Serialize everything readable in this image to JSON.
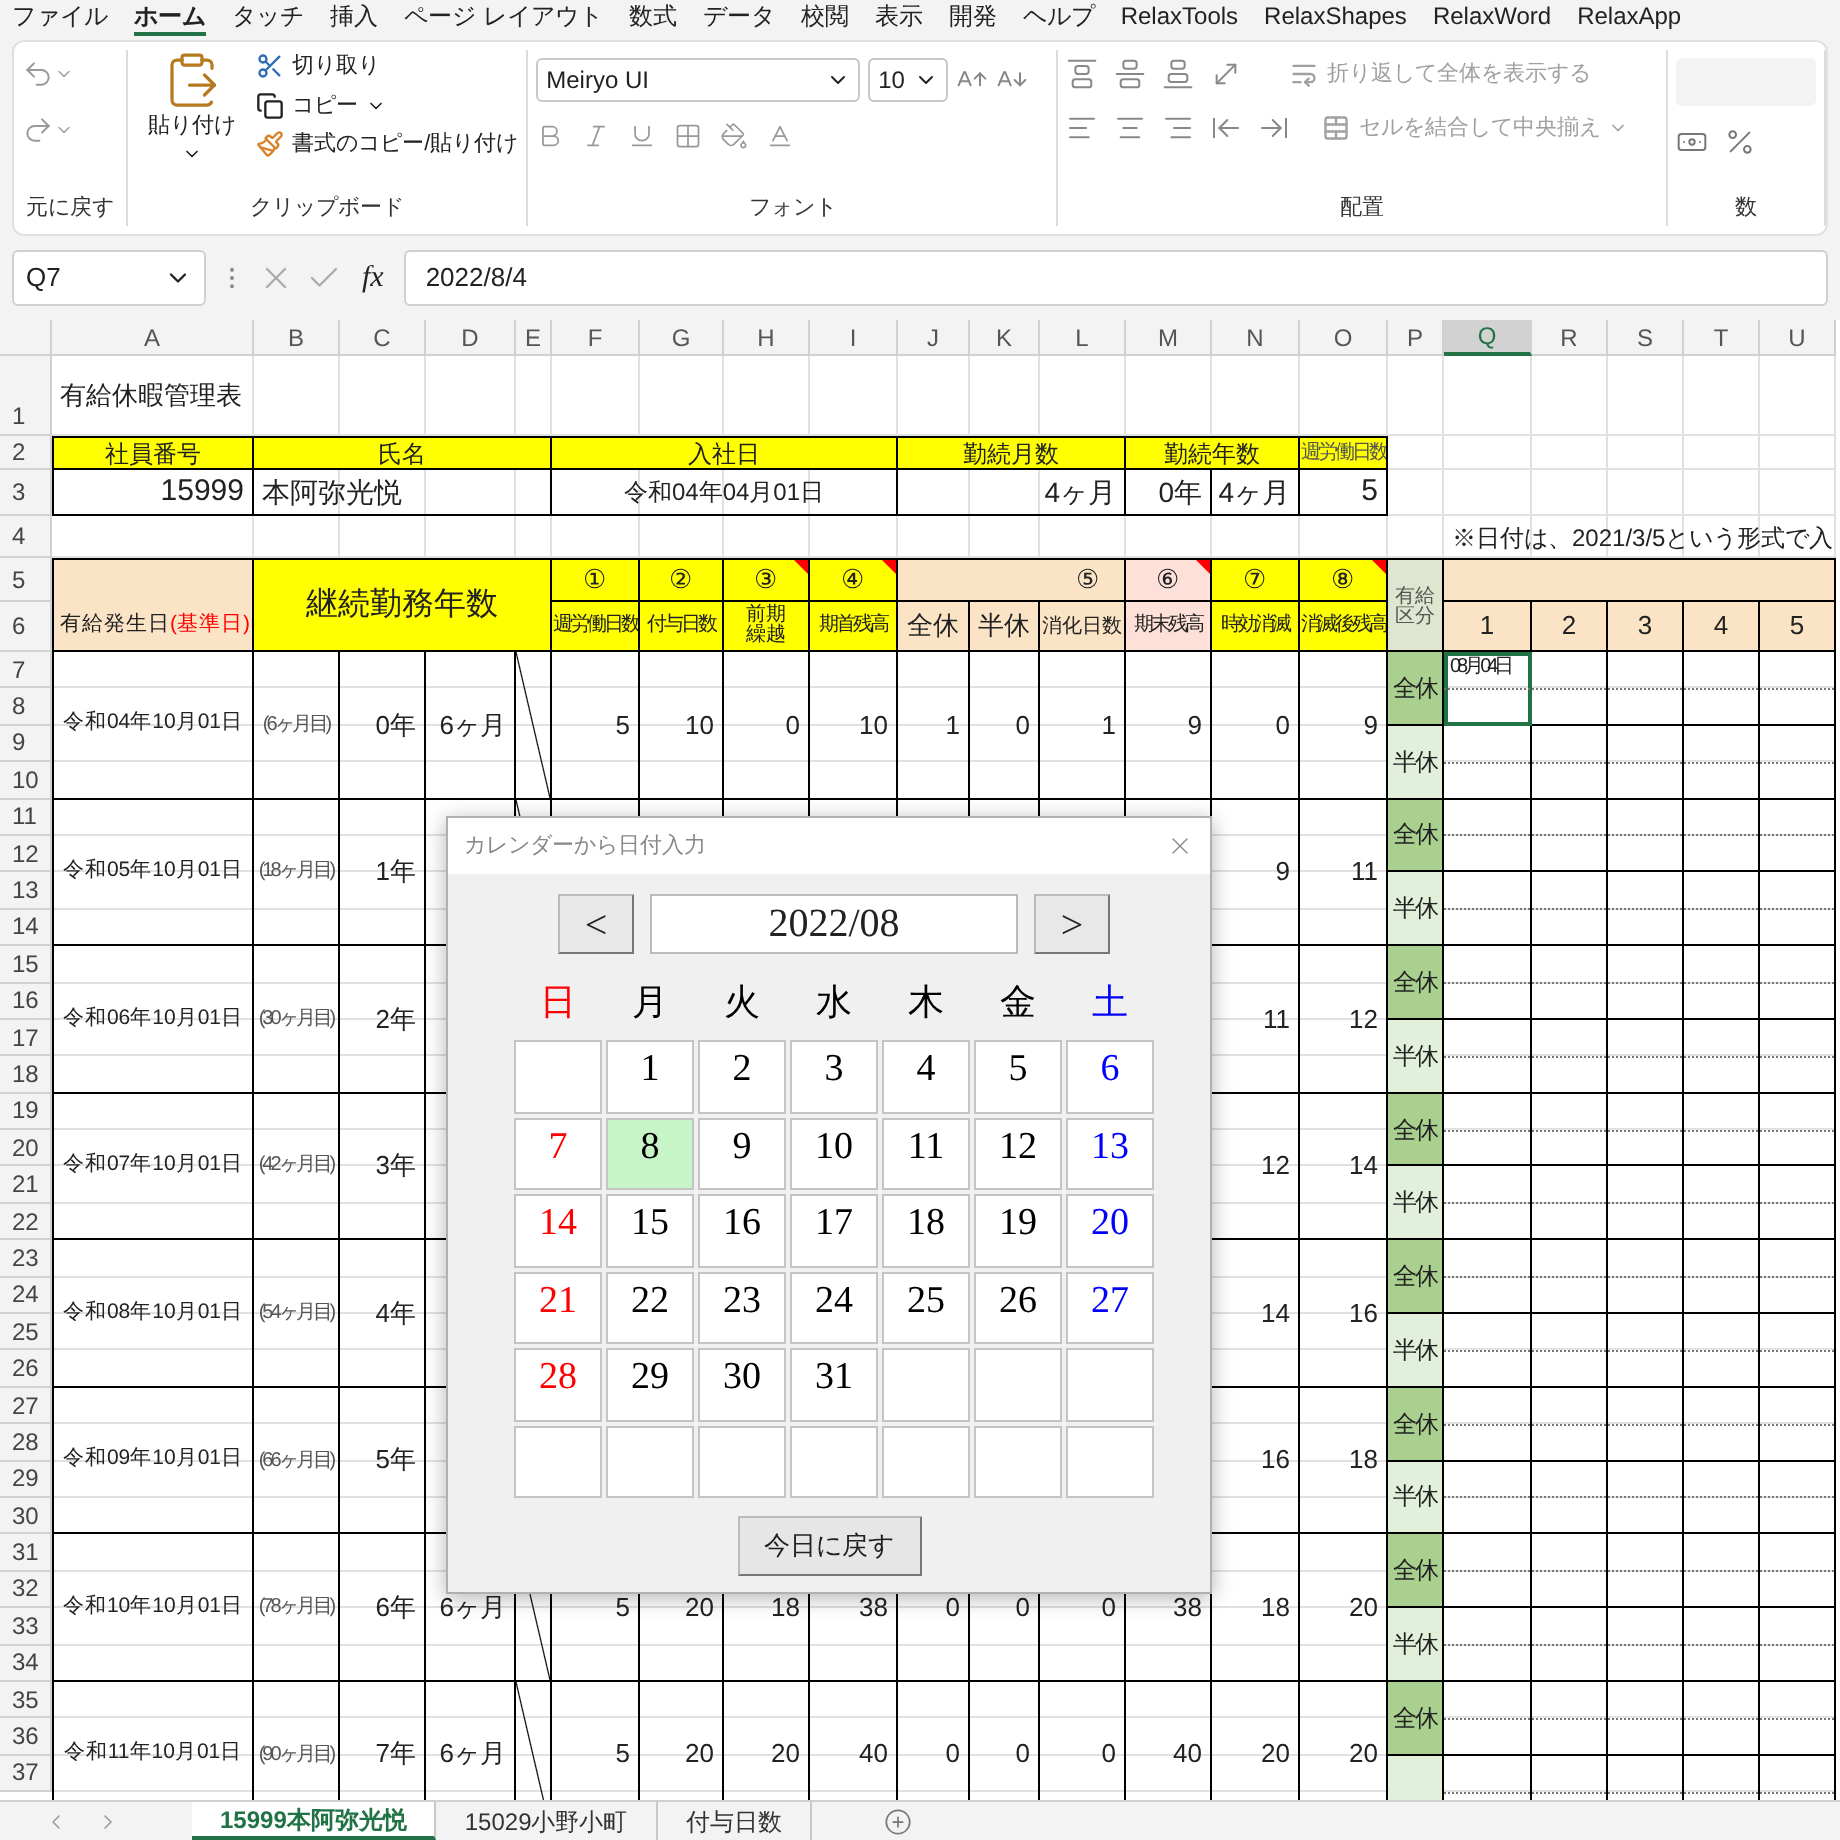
{
  "menu_tabs": [
    {
      "label": "ファイル",
      "selected": false
    },
    {
      "label": "ホーム",
      "selected": true
    },
    {
      "label": "タッチ",
      "selected": false
    },
    {
      "label": "挿入",
      "selected": false
    },
    {
      "label": "ページ レイアウト",
      "selected": false
    },
    {
      "label": "数式",
      "selected": false
    },
    {
      "label": "データ",
      "selected": false
    },
    {
      "label": "校閲",
      "selected": false
    },
    {
      "label": "表示",
      "selected": false
    },
    {
      "label": "開発",
      "selected": false
    },
    {
      "label": "ヘルプ",
      "selected": false
    },
    {
      "label": "RelaxTools",
      "selected": false
    },
    {
      "label": "RelaxShapes",
      "selected": false
    },
    {
      "label": "RelaxWord",
      "selected": false
    },
    {
      "label": "RelaxApp",
      "selected": false
    }
  ],
  "ribbon": {
    "undo": {
      "group_label": "元に戻す"
    },
    "clipboard": {
      "paste": "貼り付け",
      "cut": "切り取り",
      "copy": "コピー",
      "format_painter": "書式のコピー/貼り付け",
      "group_label": "クリップボード"
    },
    "font": {
      "font_name": "Meiryo UI",
      "font_size": "10",
      "group_label": "フォント"
    },
    "alignment": {
      "wrap_text": {
        "label": "折り返して全体を表示する",
        "disabled": true
      },
      "merge_center": {
        "label": "セルを結合して中央揃え",
        "disabled": true
      },
      "group_label": "配置"
    },
    "number": {
      "group_label": "数"
    }
  },
  "formula_bar": {
    "name_box": "Q7",
    "function_label": "fx",
    "formula": "2022/8/4"
  },
  "columns": [
    {
      "label": "A",
      "selected": false
    },
    {
      "label": "B",
      "selected": false
    },
    {
      "label": "C",
      "selected": false
    },
    {
      "label": "D",
      "selected": false
    },
    {
      "label": "E",
      "selected": false
    },
    {
      "label": "F",
      "selected": false
    },
    {
      "label": "G",
      "selected": false
    },
    {
      "label": "H",
      "selected": false
    },
    {
      "label": "I",
      "selected": false
    },
    {
      "label": "J",
      "selected": false
    },
    {
      "label": "K",
      "selected": false
    },
    {
      "label": "L",
      "selected": false
    },
    {
      "label": "M",
      "selected": false
    },
    {
      "label": "N",
      "selected": false
    },
    {
      "label": "O",
      "selected": false
    },
    {
      "label": "P",
      "selected": false
    },
    {
      "label": "Q",
      "selected": true
    },
    {
      "label": "R",
      "selected": false
    },
    {
      "label": "S",
      "selected": false
    },
    {
      "label": "T",
      "selected": false
    },
    {
      "label": "U",
      "selected": false
    }
  ],
  "row_numbers": [
    "1",
    "2",
    "3",
    "4",
    "5",
    "6",
    "7",
    "8",
    "9",
    "10",
    "11",
    "12",
    "13",
    "14",
    "15",
    "16",
    "17",
    "18",
    "19",
    "20",
    "21",
    "22",
    "23",
    "24",
    "25",
    "26",
    "27",
    "28",
    "29",
    "30",
    "31",
    "32",
    "33",
    "34",
    "35",
    "36",
    "37"
  ],
  "sheet": {
    "title": "有給休暇管理表",
    "employee_headers": [
      "社員番号",
      "氏名",
      "入社日",
      "勤続月数",
      "勤続年数",
      "週労働日数"
    ],
    "employee": {
      "id": "15999",
      "name": "本阿弥光悦",
      "hire_date": "令和04年04月01日",
      "service_months": "4ヶ月",
      "service_years": "0年",
      "service_year_months": "4ヶ月",
      "weekly_days": "5"
    },
    "note": "※日付は、2021/3/5という形式で入",
    "header": {
      "grant_date": "有給発生日",
      "grant_date_suffix": "(基準日)",
      "service_length": "継続勤務年数",
      "numbered": [
        {
          "mark": "①",
          "label": "週労働日数",
          "color": "#ffff00",
          "comment": false
        },
        {
          "mark": "②",
          "label": "付与日数",
          "color": "#ffff00",
          "comment": false
        },
        {
          "mark": "③",
          "label": "前期繰越",
          "color": "#ffff00",
          "comment": true
        },
        {
          "mark": "④",
          "label": "期首残高",
          "color": "#ffff00",
          "comment": true
        },
        {
          "mark": "⑤",
          "sub_labels": [
            "全休",
            "半休",
            "消化日数"
          ],
          "color": "#fbe4c6",
          "comment": false
        },
        {
          "mark": "⑥",
          "label": "期末残高",
          "color": "#fde0d8",
          "comment": true
        },
        {
          "mark": "⑦",
          "label": "時効消滅",
          "color": "#ffff00",
          "comment": false
        },
        {
          "mark": "⑧",
          "label": "消滅後残高",
          "color": "#ffff00",
          "comment": true
        }
      ],
      "category": "有給区分",
      "days": [
        "1",
        "2",
        "3",
        "4",
        "5"
      ]
    },
    "blocks": [
      {
        "grant_date": "令和04年10月01日",
        "month_count": "(6ヶ月目)",
        "years": "0年",
        "months": "6ヶ月",
        "weekly_days": "5",
        "granted": "10",
        "carried_over": "0",
        "opening_balance": "10",
        "full_days_taken": "1",
        "half_days_taken": "0",
        "consumed": "1",
        "closing_balance": "9",
        "expired": "0",
        "balance_after": "9",
        "full_day_label": "全休",
        "half_day_label": "半休",
        "entry": {
          "text": "08月04日",
          "selected": true
        }
      },
      {
        "grant_date": "令和05年10月01日",
        "month_count": "(18ヶ月目)",
        "years": "1年",
        "expired": "9",
        "balance_after": "11",
        "full_day_label": "全休",
        "half_day_label": "半休"
      },
      {
        "grant_date": "令和06年10月01日",
        "month_count": "(30ヶ月目)",
        "years": "2年",
        "expired": "11",
        "balance_after": "12",
        "full_day_label": "全休",
        "half_day_label": "半休"
      },
      {
        "grant_date": "令和07年10月01日",
        "month_count": "(42ヶ月目)",
        "years": "3年",
        "expired": "12",
        "balance_after": "14",
        "full_day_label": "全休",
        "half_day_label": "半休"
      },
      {
        "grant_date": "令和08年10月01日",
        "month_count": "(54ヶ月目)",
        "years": "4年",
        "expired": "14",
        "balance_after": "16",
        "full_day_label": "全休",
        "half_day_label": "半休"
      },
      {
        "grant_date": "令和09年10月01日",
        "month_count": "(66ヶ月目)",
        "years": "5年",
        "expired": "16",
        "balance_after": "18",
        "full_day_label": "全休",
        "half_day_label": "半休"
      },
      {
        "grant_date": "令和10年10月01日",
        "month_count": "(78ヶ月目)",
        "years": "6年",
        "months": "6ヶ月",
        "weekly_days": "5",
        "granted": "20",
        "carried_over": "18",
        "opening_balance": "38",
        "full_days_taken": "0",
        "half_days_taken": "0",
        "consumed": "0",
        "closing_balance": "38",
        "expired": "18",
        "balance_after": "20",
        "full_day_label": "全休",
        "half_day_label": "半休"
      },
      {
        "grant_date": "令和11年10月01日",
        "month_count": "(90ヶ月目)",
        "years": "7年",
        "months": "6ヶ月",
        "weekly_days": "5",
        "granted": "20",
        "carried_over": "20",
        "opening_balance": "40",
        "full_days_taken": "0",
        "half_days_taken": "0",
        "consumed": "0",
        "closing_balance": "40",
        "expired": "20",
        "balance_after": "20",
        "full_day_label": "全休"
      }
    ]
  },
  "calendar_dialog": {
    "title": "カレンダーから日付入力",
    "prev": "<",
    "month": "2022/08",
    "next": ">",
    "weekdays": [
      {
        "label": "日",
        "color": "#ff0000"
      },
      {
        "label": "月",
        "color": "#000000"
      },
      {
        "label": "火",
        "color": "#000000"
      },
      {
        "label": "水",
        "color": "#000000"
      },
      {
        "label": "木",
        "color": "#000000"
      },
      {
        "label": "金",
        "color": "#000000"
      },
      {
        "label": "土",
        "color": "#0000ff"
      }
    ],
    "days": [
      {
        "selected": false
      },
      {
        "day": "1",
        "selected": false
      },
      {
        "day": "2",
        "selected": false
      },
      {
        "day": "3",
        "selected": false
      },
      {
        "day": "4",
        "selected": false
      },
      {
        "day": "5",
        "selected": false
      },
      {
        "day": "6",
        "selected": false
      },
      {
        "day": "7",
        "selected": false
      },
      {
        "day": "8",
        "selected": true
      },
      {
        "day": "9",
        "selected": false
      },
      {
        "day": "10",
        "selected": false
      },
      {
        "day": "11",
        "selected": false
      },
      {
        "day": "12",
        "selected": false
      },
      {
        "day": "13",
        "selected": false
      },
      {
        "day": "14",
        "selected": false
      },
      {
        "day": "15",
        "selected": false
      },
      {
        "day": "16",
        "selected": false
      },
      {
        "day": "17",
        "selected": false
      },
      {
        "day": "18",
        "selected": false
      },
      {
        "day": "19",
        "selected": false
      },
      {
        "day": "20",
        "selected": false
      },
      {
        "day": "21",
        "selected": false
      },
      {
        "day": "22",
        "selected": false
      },
      {
        "day": "23",
        "selected": false
      },
      {
        "day": "24",
        "selected": false
      },
      {
        "day": "25",
        "selected": false
      },
      {
        "day": "26",
        "selected": false
      },
      {
        "day": "27",
        "selected": false
      },
      {
        "day": "28",
        "selected": false
      },
      {
        "day": "29",
        "selected": false
      },
      {
        "day": "30",
        "selected": false
      },
      {
        "day": "31",
        "selected": false
      },
      {
        "selected": false
      },
      {
        "selected": false
      },
      {
        "selected": false
      },
      {
        "selected": false
      },
      {
        "selected": false
      },
      {
        "selected": false
      },
      {
        "selected": false
      },
      {
        "selected": false
      },
      {
        "selected": false
      },
      {
        "selected": false
      }
    ],
    "today_button": "今日に戻す"
  },
  "sheet_tabs": [
    {
      "label": "15999本阿弥光悦",
      "selected": true
    },
    {
      "label": "15029小野小町",
      "selected": false
    },
    {
      "label": "付与日数",
      "selected": false
    }
  ]
}
